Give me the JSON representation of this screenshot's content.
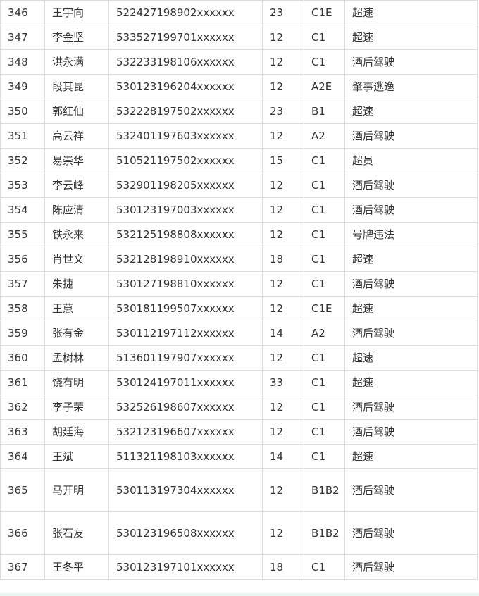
{
  "table": {
    "rows": [
      {
        "no": "346",
        "name": "王宇向",
        "id": "522427198902xxxxxx",
        "points": "23",
        "license": "C1E",
        "violation": "超速"
      },
      {
        "no": "347",
        "name": "李金坚",
        "id": "533527199701xxxxxx",
        "points": "12",
        "license": "C1",
        "violation": "超速"
      },
      {
        "no": "348",
        "name": "洪永满",
        "id": "532233198106xxxxxx",
        "points": "12",
        "license": "C1",
        "violation": "酒后驾驶"
      },
      {
        "no": "349",
        "name": "段其昆",
        "id": "530123196204xxxxxx",
        "points": "12",
        "license": "A2E",
        "violation": "肇事逃逸"
      },
      {
        "no": "350",
        "name": "郭红仙",
        "id": "532228197502xxxxxx",
        "points": "23",
        "license": "B1",
        "violation": "超速"
      },
      {
        "no": "351",
        "name": "高云祥",
        "id": "532401197603xxxxxx",
        "points": "12",
        "license": "A2",
        "violation": "酒后驾驶"
      },
      {
        "no": "352",
        "name": "易崇华",
        "id": "510521197502xxxxxx",
        "points": "15",
        "license": "C1",
        "violation": "超员"
      },
      {
        "no": "353",
        "name": "李云峰",
        "id": "532901198205xxxxxx",
        "points": "12",
        "license": "C1",
        "violation": "酒后驾驶"
      },
      {
        "no": "354",
        "name": "陈应清",
        "id": "530123197003xxxxxx",
        "points": "12",
        "license": "C1",
        "violation": "酒后驾驶"
      },
      {
        "no": "355",
        "name": "铁永来",
        "id": "532125198808xxxxxx",
        "points": "12",
        "license": "C1",
        "violation": "号牌违法"
      },
      {
        "no": "356",
        "name": "肖世文",
        "id": "532128198910xxxxxx",
        "points": "18",
        "license": "C1",
        "violation": "超速"
      },
      {
        "no": "357",
        "name": "朱捷",
        "id": "530127198810xxxxxx",
        "points": "12",
        "license": "C1",
        "violation": "酒后驾驶"
      },
      {
        "no": "358",
        "name": "王葸",
        "id": "530181199507xxxxxx",
        "points": "12",
        "license": "C1E",
        "violation": "超速"
      },
      {
        "no": "359",
        "name": "张有金",
        "id": "530112197112xxxxxx",
        "points": "14",
        "license": "A2",
        "violation": "酒后驾驶"
      },
      {
        "no": "360",
        "name": "孟树林",
        "id": "513601197907xxxxxx",
        "points": "12",
        "license": "C1",
        "violation": "超速"
      },
      {
        "no": "361",
        "name": "饶有明",
        "id": "530124197011xxxxxx",
        "points": "33",
        "license": "C1",
        "violation": "超速"
      },
      {
        "no": "362",
        "name": "李子荣",
        "id": "532526198607xxxxxx",
        "points": "12",
        "license": "C1",
        "violation": "酒后驾驶"
      },
      {
        "no": "363",
        "name": "胡廷海",
        "id": "532123196607xxxxxx",
        "points": "12",
        "license": "C1",
        "violation": "酒后驾驶"
      },
      {
        "no": "364",
        "name": "王斌",
        "id": "511321198103xxxxxx",
        "points": "14",
        "license": "C1",
        "violation": "超速"
      },
      {
        "no": "365",
        "name": "马开明",
        "id": "530113197304xxxxxx",
        "points": "12",
        "license": "B1B2",
        "violation": "酒后驾驶"
      },
      {
        "no": "366",
        "name": "张石友",
        "id": "530123196508xxxxxx",
        "points": "12",
        "license": "B1B2",
        "violation": "酒后驾驶"
      },
      {
        "no": "367",
        "name": "王冬平",
        "id": "530123197101xxxxxx",
        "points": "18",
        "license": "C1",
        "violation": "酒后驾驶"
      }
    ]
  }
}
